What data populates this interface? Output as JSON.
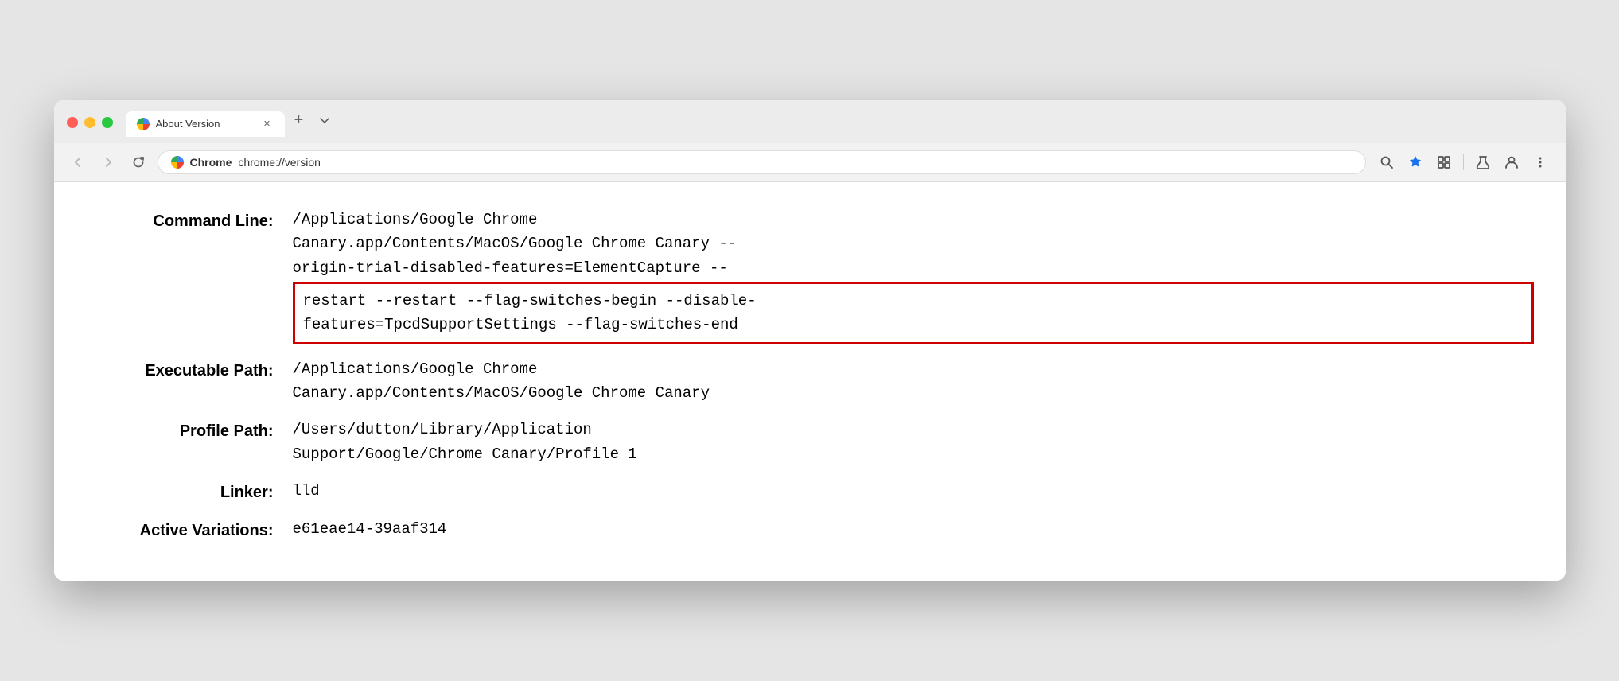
{
  "window": {
    "title": "About Version",
    "tab_label": "About Version",
    "url_site": "Chrome",
    "url_full": "chrome://version"
  },
  "toolbar": {
    "back_label": "←",
    "forward_label": "→",
    "reload_label": "↻",
    "search_label": "🔍",
    "bookmark_label": "★",
    "extensions_label": "⬜",
    "labs_label": "⚗",
    "profile_label": "👤",
    "menu_label": "⋮",
    "tab_list_label": "⌄",
    "tab_close_label": "✕",
    "tab_new_label": "+"
  },
  "page": {
    "rows": [
      {
        "label": "Command Line:",
        "value_normal": "/Applications/Google Chrome\nCanary.app/Contents/MacOS/Google Chrome Canary --\norigin-trial-disabled-features=ElementCapture --",
        "value_highlighted": "restart --restart --flag-switches-begin --disable-\nfeatures=TpcdSupportSettings --flag-switches-end",
        "has_highlight": true
      },
      {
        "label": "Executable Path:",
        "value": "/Applications/Google Chrome\nCanary.app/Contents/MacOS/Google Chrome Canary",
        "has_highlight": false
      },
      {
        "label": "Profile Path:",
        "value": "/Users/dutton/Library/Application\nSupport/Google/Chrome Canary/Profile 1",
        "has_highlight": false
      },
      {
        "label": "Linker:",
        "value": "lld",
        "has_highlight": false
      },
      {
        "label": "Active Variations:",
        "value": "e61eae14-39aaf314",
        "has_highlight": false
      }
    ]
  }
}
